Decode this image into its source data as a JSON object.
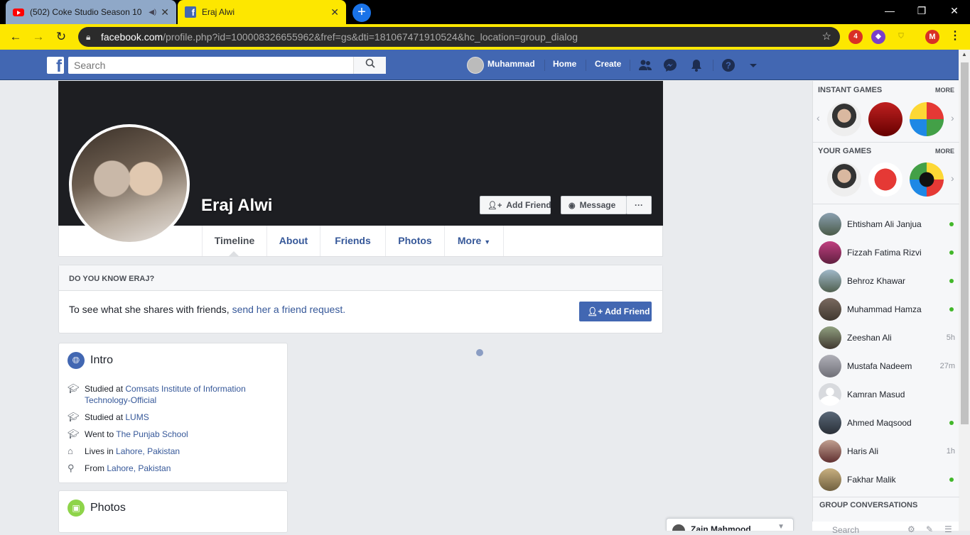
{
  "browser": {
    "tabs": [
      {
        "title": "(502) Coke Studio Season 10",
        "icon": "youtube-icon",
        "active": false
      },
      {
        "title": "Eraj Alwi",
        "icon": "facebook-icon",
        "active": true
      }
    ],
    "url_host": "facebook.com",
    "url_path": "/profile.php?id=100008326655962&fref=gs&dti=181067471910524&hc_location=group_dialog",
    "extension_badge": "4",
    "profile_initial": "M",
    "accent": "#fde700"
  },
  "fb_header": {
    "search_placeholder": "Search",
    "user_name": "Muhammad",
    "home": "Home",
    "create": "Create",
    "brand_color": "#4267b2"
  },
  "profile": {
    "name": "Eraj Alwi",
    "add_friend": "Add Friend",
    "message": "Message",
    "more_dots": "···",
    "tabs": [
      "Timeline",
      "About",
      "Friends",
      "Photos",
      "More"
    ]
  },
  "know": {
    "heading": "DO YOU KNOW ERAJ?",
    "text": "To see what she shares with friends, ",
    "link": "send her a friend request.",
    "button": "Add Friend"
  },
  "intro": {
    "title": "Intro",
    "rows": [
      {
        "prefix": "Studied at ",
        "link": "Comsats Institute of Information Technology-Official",
        "icon": "graduation-cap-icon"
      },
      {
        "prefix": "Studied at ",
        "link": "LUMS",
        "icon": "graduation-cap-icon"
      },
      {
        "prefix": "Went to ",
        "link": "The Punjab School",
        "icon": "graduation-cap-icon"
      },
      {
        "prefix": "Lives in ",
        "link": "Lahore, Pakistan",
        "icon": "home-icon"
      },
      {
        "prefix": "From ",
        "link": "Lahore, Pakistan",
        "icon": "location-pin-icon"
      }
    ]
  },
  "photos": {
    "title": "Photos"
  },
  "sidebar": {
    "instant_games": "INSTANT GAMES",
    "your_games": "YOUR GAMES",
    "more": "MORE",
    "group_conversations": "GROUP CONVERSATIONS",
    "search_placeholder": "Search",
    "friends": [
      {
        "name": "Ehtisham Ali Janjua",
        "status": "online",
        "ago": ""
      },
      {
        "name": "Fizzah Fatima Rizvi",
        "status": "online",
        "ago": ""
      },
      {
        "name": "Behroz Khawar",
        "status": "online",
        "ago": ""
      },
      {
        "name": "Muhammad Hamza",
        "status": "online",
        "ago": ""
      },
      {
        "name": "Zeeshan Ali",
        "status": "away",
        "ago": "5h"
      },
      {
        "name": "Mustafa Nadeem",
        "status": "away",
        "ago": "27m"
      },
      {
        "name": "Kamran Masud",
        "status": "offline",
        "ago": ""
      },
      {
        "name": "Ahmed Maqsood",
        "status": "online",
        "ago": ""
      },
      {
        "name": "Haris Ali",
        "status": "away",
        "ago": "1h"
      },
      {
        "name": "Fakhar Malik",
        "status": "online",
        "ago": ""
      }
    ]
  },
  "chat_tab": {
    "name": "Zain Mahmood"
  }
}
